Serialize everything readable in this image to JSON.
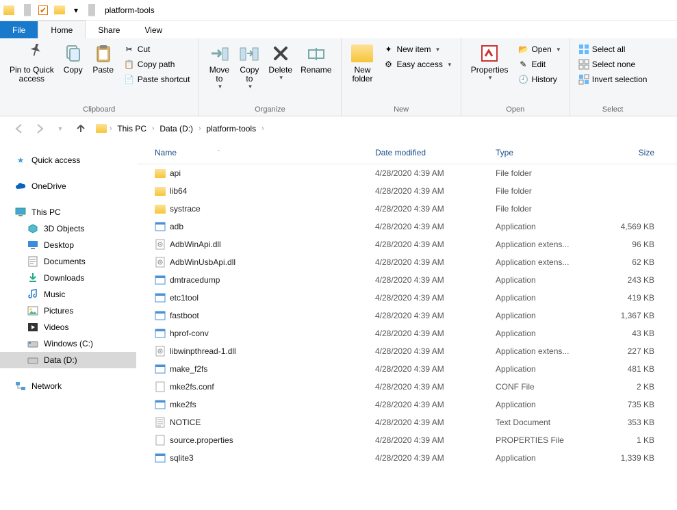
{
  "titlebar": {
    "title": "platform-tools"
  },
  "tabs": {
    "file": "File",
    "home": "Home",
    "share": "Share",
    "view": "View"
  },
  "ribbon": {
    "clipboard": {
      "label": "Clipboard",
      "pin": "Pin to Quick\naccess",
      "copy": "Copy",
      "paste": "Paste",
      "cut": "Cut",
      "copy_path": "Copy path",
      "paste_shortcut": "Paste shortcut"
    },
    "organize": {
      "label": "Organize",
      "move_to": "Move\nto",
      "copy_to": "Copy\nto",
      "delete": "Delete",
      "rename": "Rename"
    },
    "new": {
      "label": "New",
      "new_folder": "New\nfolder",
      "new_item": "New item",
      "easy_access": "Easy access"
    },
    "open": {
      "label": "Open",
      "properties": "Properties",
      "open": "Open",
      "edit": "Edit",
      "history": "History"
    },
    "select": {
      "label": "Select",
      "select_all": "Select all",
      "select_none": "Select none",
      "invert": "Invert selection"
    }
  },
  "breadcrumb": [
    "This PC",
    "Data (D:)",
    "platform-tools"
  ],
  "nav": {
    "quick_access": "Quick access",
    "onedrive": "OneDrive",
    "this_pc": "This PC",
    "subs": [
      "3D Objects",
      "Desktop",
      "Documents",
      "Downloads",
      "Music",
      "Pictures",
      "Videos",
      "Windows (C:)",
      "Data (D:)"
    ],
    "network": "Network"
  },
  "columns": {
    "name": "Name",
    "date": "Date modified",
    "type": "Type",
    "size": "Size"
  },
  "files": [
    {
      "name": "api",
      "date": "4/28/2020 4:39 AM",
      "type": "File folder",
      "size": "",
      "icon": "folder"
    },
    {
      "name": "lib64",
      "date": "4/28/2020 4:39 AM",
      "type": "File folder",
      "size": "",
      "icon": "folder"
    },
    {
      "name": "systrace",
      "date": "4/28/2020 4:39 AM",
      "type": "File folder",
      "size": "",
      "icon": "folder"
    },
    {
      "name": "adb",
      "date": "4/28/2020 4:39 AM",
      "type": "Application",
      "size": "4,569 KB",
      "icon": "exe"
    },
    {
      "name": "AdbWinApi.dll",
      "date": "4/28/2020 4:39 AM",
      "type": "Application extens...",
      "size": "96 KB",
      "icon": "dll"
    },
    {
      "name": "AdbWinUsbApi.dll",
      "date": "4/28/2020 4:39 AM",
      "type": "Application extens...",
      "size": "62 KB",
      "icon": "dll"
    },
    {
      "name": "dmtracedump",
      "date": "4/28/2020 4:39 AM",
      "type": "Application",
      "size": "243 KB",
      "icon": "exe"
    },
    {
      "name": "etc1tool",
      "date": "4/28/2020 4:39 AM",
      "type": "Application",
      "size": "419 KB",
      "icon": "exe"
    },
    {
      "name": "fastboot",
      "date": "4/28/2020 4:39 AM",
      "type": "Application",
      "size": "1,367 KB",
      "icon": "exe"
    },
    {
      "name": "hprof-conv",
      "date": "4/28/2020 4:39 AM",
      "type": "Application",
      "size": "43 KB",
      "icon": "exe"
    },
    {
      "name": "libwinpthread-1.dll",
      "date": "4/28/2020 4:39 AM",
      "type": "Application extens...",
      "size": "227 KB",
      "icon": "dll"
    },
    {
      "name": "make_f2fs",
      "date": "4/28/2020 4:39 AM",
      "type": "Application",
      "size": "481 KB",
      "icon": "exe"
    },
    {
      "name": "mke2fs.conf",
      "date": "4/28/2020 4:39 AM",
      "type": "CONF File",
      "size": "2 KB",
      "icon": "file"
    },
    {
      "name": "mke2fs",
      "date": "4/28/2020 4:39 AM",
      "type": "Application",
      "size": "735 KB",
      "icon": "exe"
    },
    {
      "name": "NOTICE",
      "date": "4/28/2020 4:39 AM",
      "type": "Text Document",
      "size": "353 KB",
      "icon": "txt"
    },
    {
      "name": "source.properties",
      "date": "4/28/2020 4:39 AM",
      "type": "PROPERTIES File",
      "size": "1 KB",
      "icon": "file"
    },
    {
      "name": "sqlite3",
      "date": "4/28/2020 4:39 AM",
      "type": "Application",
      "size": "1,339 KB",
      "icon": "exe"
    }
  ]
}
